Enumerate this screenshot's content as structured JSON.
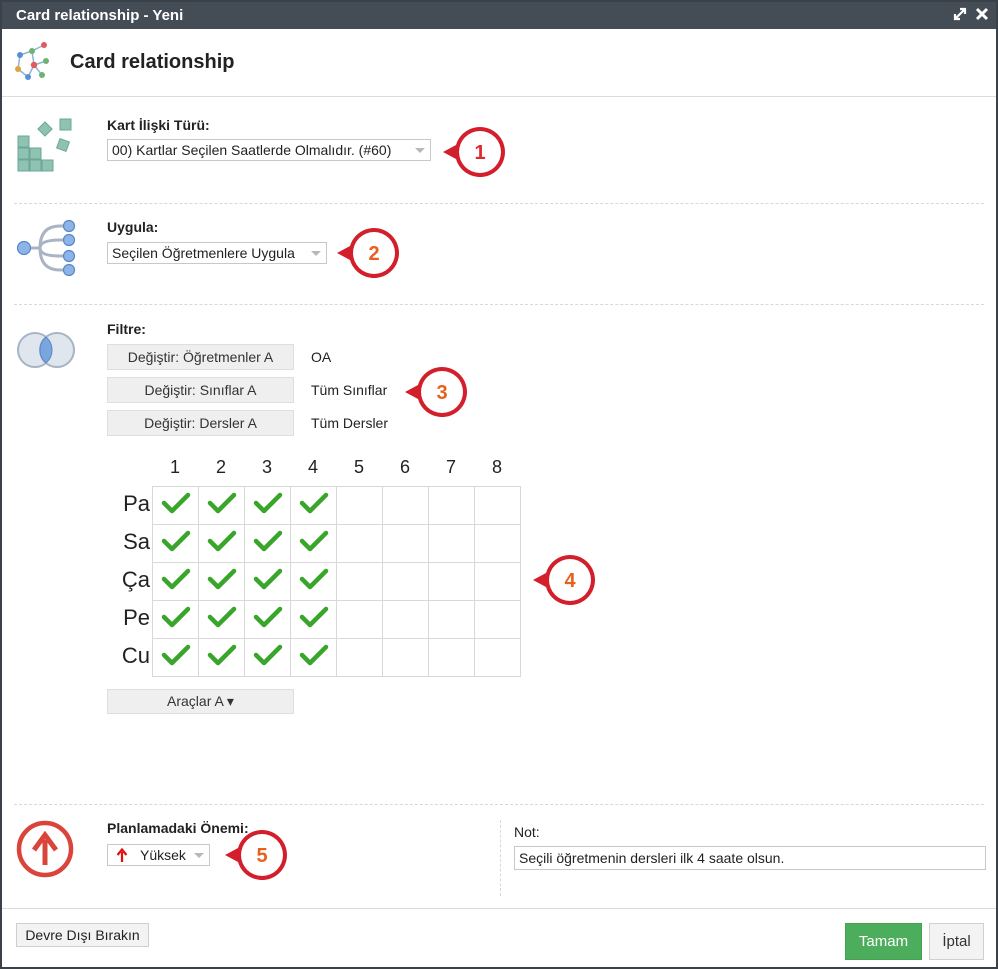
{
  "window": {
    "title": "Card relationship - Yeni"
  },
  "header": {
    "title": "Card relationship"
  },
  "relation_type": {
    "label": "Kart İlişki Türü:",
    "value": "00) Kartlar Seçilen Saatlerde Olmalıdır. (#60)"
  },
  "apply": {
    "label": "Uygula:",
    "value": "Seçilen Öğretmenlere Uygula"
  },
  "filter": {
    "label": "Filtre:",
    "rows": [
      {
        "button": "Değiştir: Öğretmenler A",
        "value": "OA"
      },
      {
        "button": "Değiştir: Sınıflar A",
        "value": "Tüm Sınıflar"
      },
      {
        "button": "Değiştir: Dersler A",
        "value": "Tüm Dersler"
      }
    ]
  },
  "grid": {
    "columns": [
      "1",
      "2",
      "3",
      "4",
      "5",
      "6",
      "7",
      "8"
    ],
    "rows": [
      "Pa",
      "Sa",
      "Ça",
      "Pe",
      "Cu"
    ],
    "checked": [
      [
        true,
        true,
        true,
        true,
        false,
        false,
        false,
        false
      ],
      [
        true,
        true,
        true,
        true,
        false,
        false,
        false,
        false
      ],
      [
        true,
        true,
        true,
        true,
        false,
        false,
        false,
        false
      ],
      [
        true,
        true,
        true,
        true,
        false,
        false,
        false,
        false
      ],
      [
        true,
        true,
        true,
        true,
        false,
        false,
        false,
        false
      ]
    ]
  },
  "tools": {
    "label": "Araçlar A ▾"
  },
  "importance": {
    "label": "Planlamadaki Önemi:",
    "value": "Yüksek"
  },
  "note": {
    "label": "Not:",
    "value": "Seçili öğretmenin dersleri ilk 4 saate olsun."
  },
  "markers": [
    "1",
    "2",
    "3",
    "4",
    "5"
  ],
  "footer": {
    "disable_label": "Devre Dışı Bırakın",
    "ok_label": "Tamam",
    "cancel_label": "İptal"
  },
  "colors": {
    "titlebar": "#444c55",
    "ok": "#4cae5c",
    "marker": "#d21f2b",
    "check": "#3aa52b",
    "importance": "#d9453a"
  }
}
